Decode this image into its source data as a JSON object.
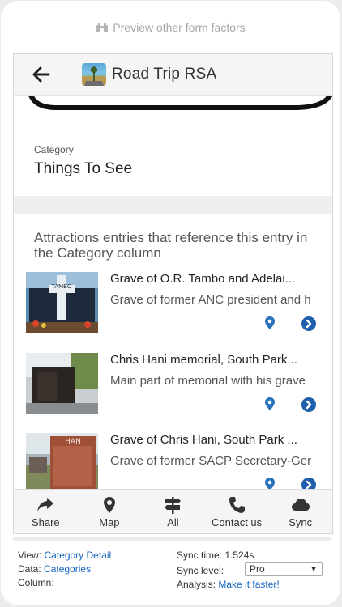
{
  "preview": {
    "label": "Preview other form factors"
  },
  "header": {
    "title": "Road Trip RSA"
  },
  "detail": {
    "label": "Category",
    "value": "Things To See"
  },
  "list": {
    "heading": "Attractions entries that reference this entry in the Category column",
    "rows": [
      {
        "title": "Grave of O.R. Tambo and Adelai...",
        "subtitle": "Grave of former ANC president and h",
        "thumb_text": "TAMBO"
      },
      {
        "title": "Chris Hani memorial, South Park...",
        "subtitle": "Main part of memorial with his grave"
      },
      {
        "title": "Grave of Chris Hani, South Park ...",
        "subtitle": "Grave of former SACP Secretary-Ger",
        "thumb_text": "HAN"
      }
    ]
  },
  "toolbar": {
    "share": "Share",
    "map": "Map",
    "all": "All",
    "contact": "Contact us",
    "sync": "Sync"
  },
  "info": {
    "view_label": "View:",
    "view_value": "Category Detail",
    "data_label": "Data:",
    "data_value": "Categories",
    "column_label": "Column:",
    "sync_time": "Sync time: 1.524s",
    "sync_level_label": "Sync level:",
    "sync_level_value": "Pro",
    "analysis_label": "Analysis:",
    "analysis_link": "Make it faster!"
  },
  "colors": {
    "accent": "#1565c0",
    "icon_blue": "#2a72bb"
  }
}
